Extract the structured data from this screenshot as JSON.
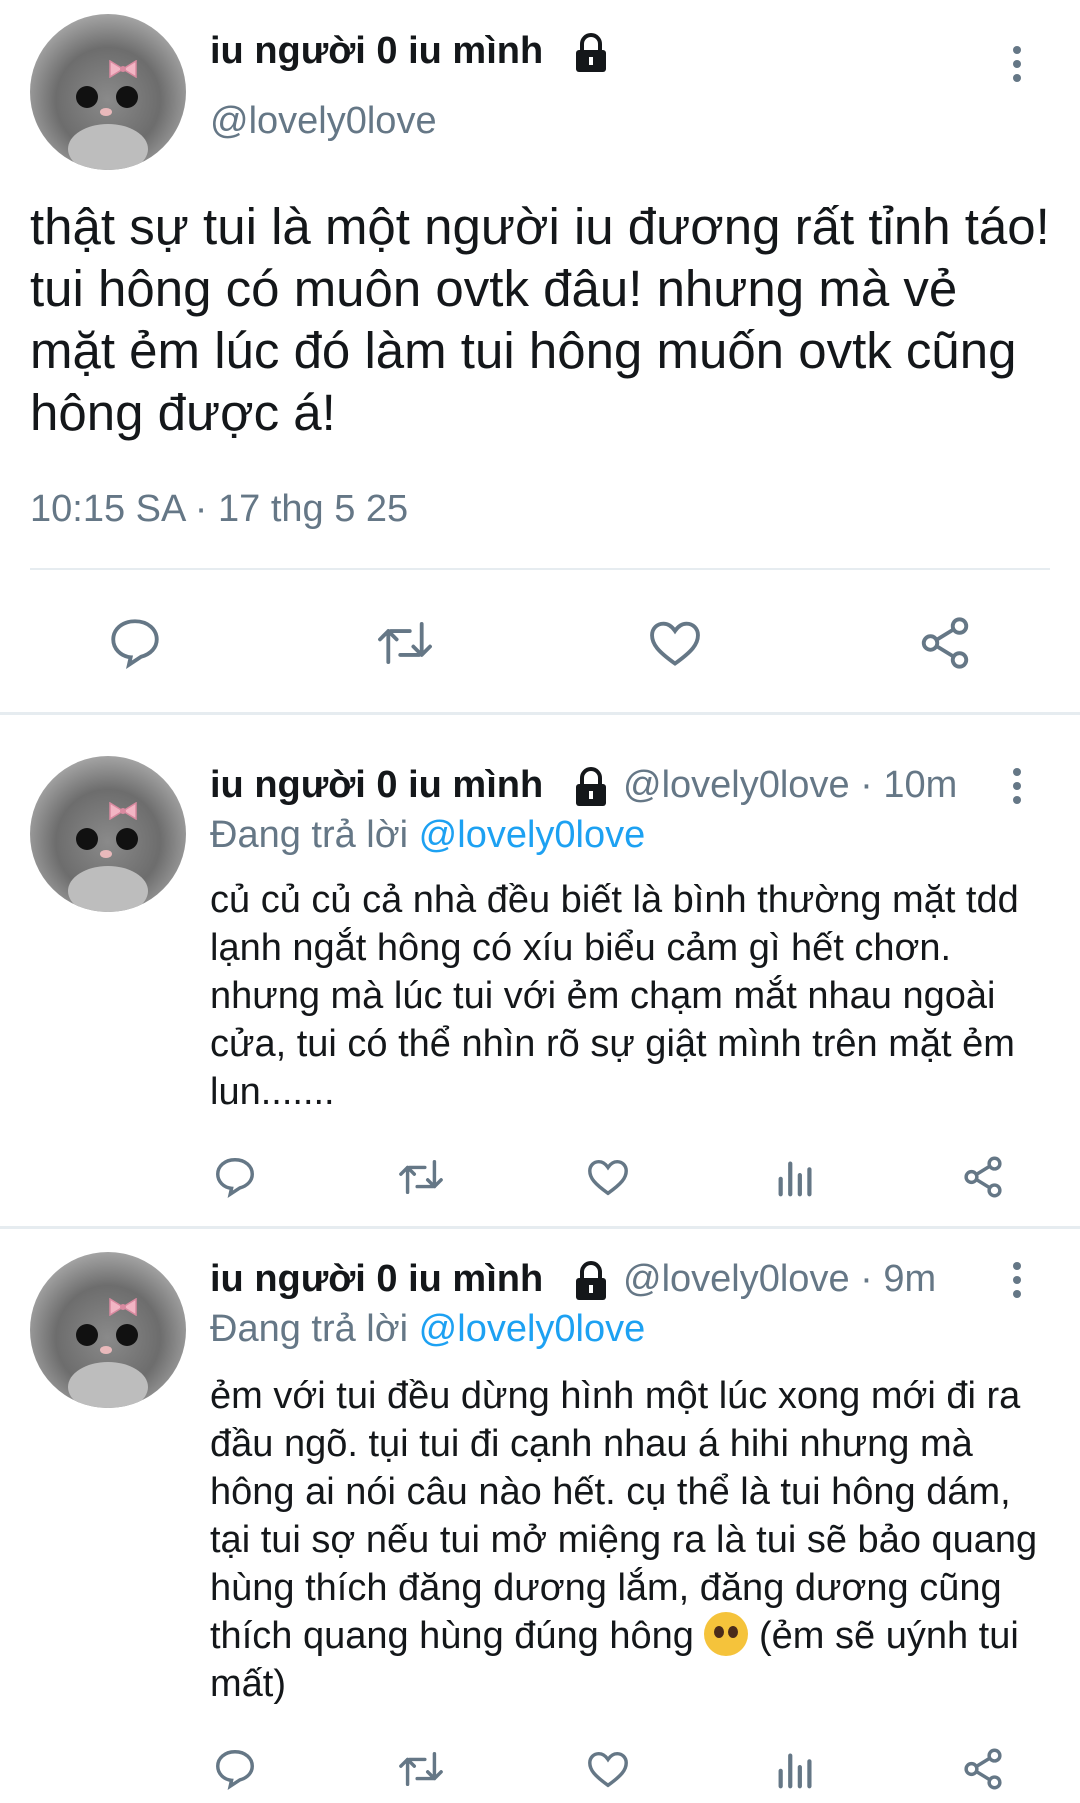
{
  "main_tweet": {
    "name": "iu người 0 iu mình",
    "handle": "@lovely0love",
    "text": "thật sự tui là một người iu đương rất tỉnh táo! tui hông có muôn ovtk đâu! nhưng mà vẻ mặt ẻm lúc đó làm tui hông muốn ovtk cũng hông được á!",
    "timestamp": "10:15 SA · 17 thg 5 25"
  },
  "replies": [
    {
      "name": "iu người 0 iu mình",
      "handle_time": "@lovely0love · 10m",
      "replying_prefix": "Đang trả lời ",
      "replying_to": "@lovely0love",
      "text": "củ củ củ cả nhà đều biết là bình thường mặt tdd lạnh ngắt hông có xíu biểu cảm gì hết chơn. nhưng mà lúc tui với ẻm chạm mắt nhau ngoài cửa, tui có thể nhìn rõ sự giật mình trên mặt ẻm lun......."
    },
    {
      "name": "iu người 0 iu mình",
      "handle_time": "@lovely0love · 9m",
      "replying_prefix": "Đang trả lời ",
      "replying_to": "@lovely0love",
      "text_before_emoji": "ẻm với tui đều dừng hình một lúc xong mới đi ra đầu ngõ. tụi tui đi cạnh nhau á hihi nhưng mà hông ai nói câu nào hết. cụ thể là tui hông dám, tại tui sợ nếu tui mở miệng ra là tui sẽ bảo quang hùng thích đăng dương lắm, đăng dương cũng thích quang hùng đúng hông ",
      "emoji": "pleading-face-emoji",
      "text_after_emoji": " (ẻm sẽ uýnh tui mất)"
    }
  ],
  "colors": {
    "text": "#14171a",
    "muted": "#657786",
    "link": "#1da1f2",
    "divider": "#e6ecf0"
  }
}
